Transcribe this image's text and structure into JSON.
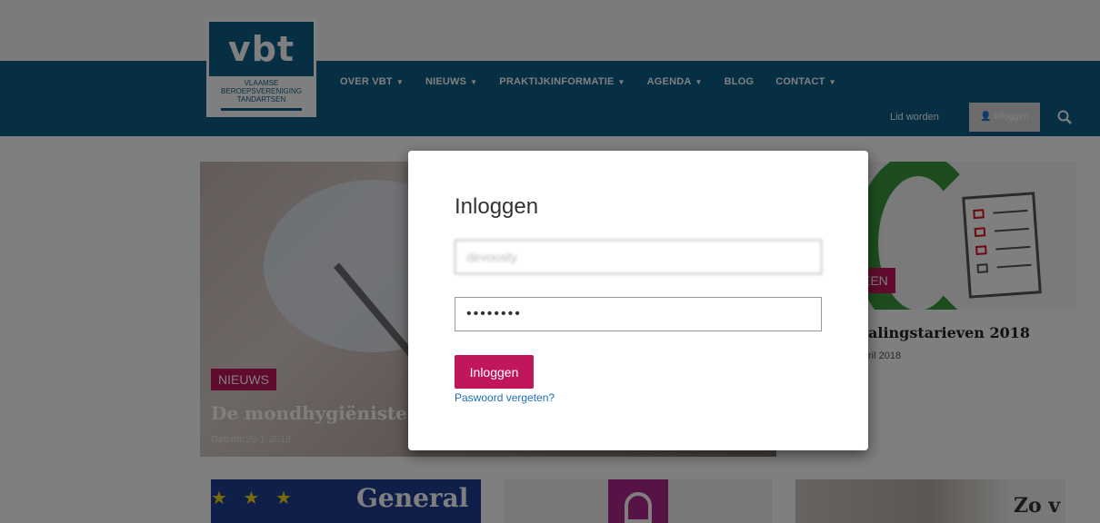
{
  "logo": {
    "mark": "vbt",
    "subtitle_lines": [
      "VLAAMSE",
      "BEROEPSVERENIGING",
      "TANDARTSEN"
    ]
  },
  "nav": {
    "items": [
      {
        "label": "OVER VBT",
        "has_dropdown": true
      },
      {
        "label": "NIEUWS",
        "has_dropdown": true
      },
      {
        "label": "PRAKTIJKINFORMATIE",
        "has_dropdown": true
      },
      {
        "label": "AGENDA",
        "has_dropdown": true
      },
      {
        "label": "BLOG",
        "has_dropdown": false
      },
      {
        "label": "CONTACT",
        "has_dropdown": true
      }
    ],
    "lid_worden": "Lid worden",
    "login_label": "Inloggen",
    "search_icon": "search-icon"
  },
  "cards": {
    "main": {
      "badge": "NIEUWS",
      "title": "De mondhygiënisten",
      "date_label": "Datum:",
      "date_value": "20-1-2018"
    },
    "right": {
      "badge": "EEN",
      "title": "alingstarieven 2018",
      "date": "ril 2018"
    },
    "bottom_left_text": "General",
    "bottom_right_text": "Zo v"
  },
  "modal": {
    "title": "Inloggen",
    "username_value": "devoosty",
    "password_value": "••••••••",
    "submit_label": "Inloggen",
    "forgot_label": "Paswoord vergeten?"
  },
  "colors": {
    "brand_blue": "#0c5e86",
    "accent_pink": "#c0175c",
    "link_blue": "#1d6fb8"
  }
}
